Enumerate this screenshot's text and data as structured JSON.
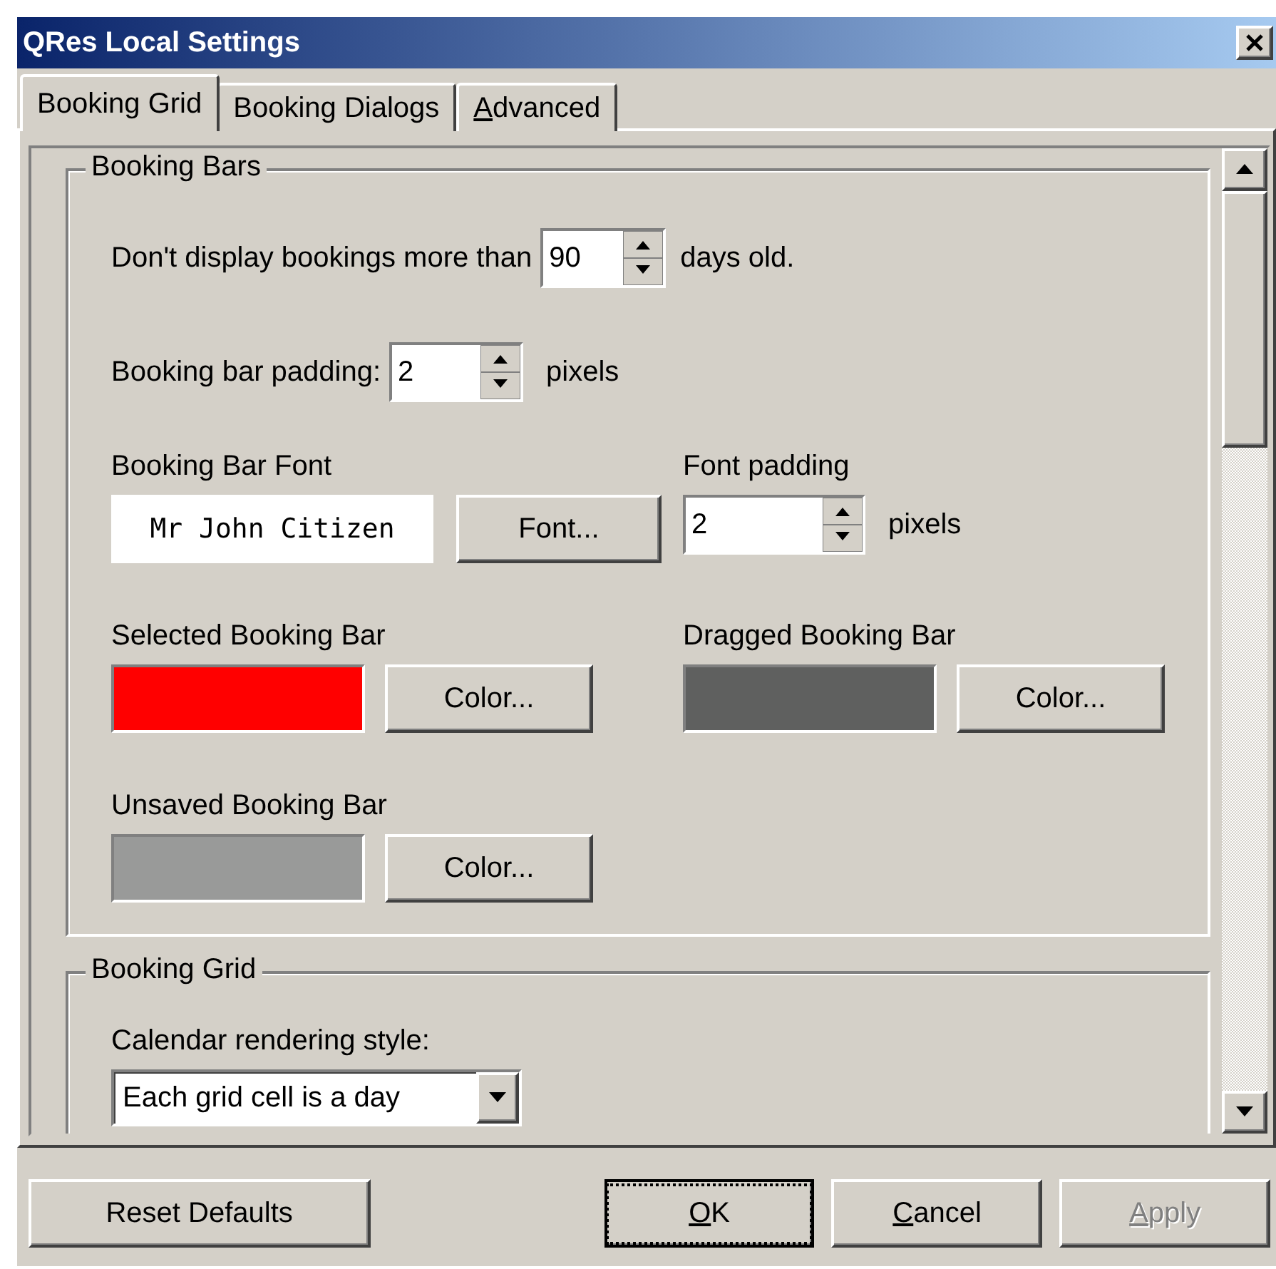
{
  "window": {
    "title": "QRes Local Settings"
  },
  "tabs": [
    {
      "label": "Booking Grid",
      "selected": true,
      "mnemonic": false
    },
    {
      "label": "Booking Dialogs",
      "selected": false,
      "mnemonic": false
    },
    {
      "label": "Advanced",
      "selected": false,
      "mnemonic": true
    }
  ],
  "booking_bars": {
    "title": "Booking Bars",
    "max_age": {
      "label_before": "Don't display bookings more than",
      "value": "90",
      "label_after": "days old."
    },
    "bar_padding": {
      "label": "Booking bar padding:",
      "value": "2",
      "unit": "pixels"
    },
    "font": {
      "label": "Booking Bar Font",
      "preview": "Mr John Citizen",
      "button": "Font..."
    },
    "font_padding": {
      "label": "Font padding",
      "value": "2",
      "unit": "pixels"
    },
    "bar_colors": [
      {
        "label": "Selected Booking Bar",
        "color": "#ff0000",
        "button": "Color..."
      },
      {
        "label": "Dragged Booking Bar",
        "color": "#5f605f",
        "button": "Color..."
      },
      {
        "label": "Unsaved Booking Bar",
        "color": "#999a99",
        "button": "Color..."
      }
    ]
  },
  "booking_grid": {
    "title": "Booking Grid",
    "rendering_style": {
      "label": "Calendar rendering style:",
      "value": "Each grid cell is a day"
    }
  },
  "buttons": [
    {
      "label": "Reset Defaults",
      "default": false,
      "disabled": false,
      "mnemonic": false
    },
    {
      "label": "OK",
      "default": true,
      "disabled": false,
      "mnemonic": true
    },
    {
      "label": "Cancel",
      "default": false,
      "disabled": false,
      "mnemonic": true
    },
    {
      "label": "Apply",
      "default": false,
      "disabled": true,
      "mnemonic": true
    }
  ]
}
